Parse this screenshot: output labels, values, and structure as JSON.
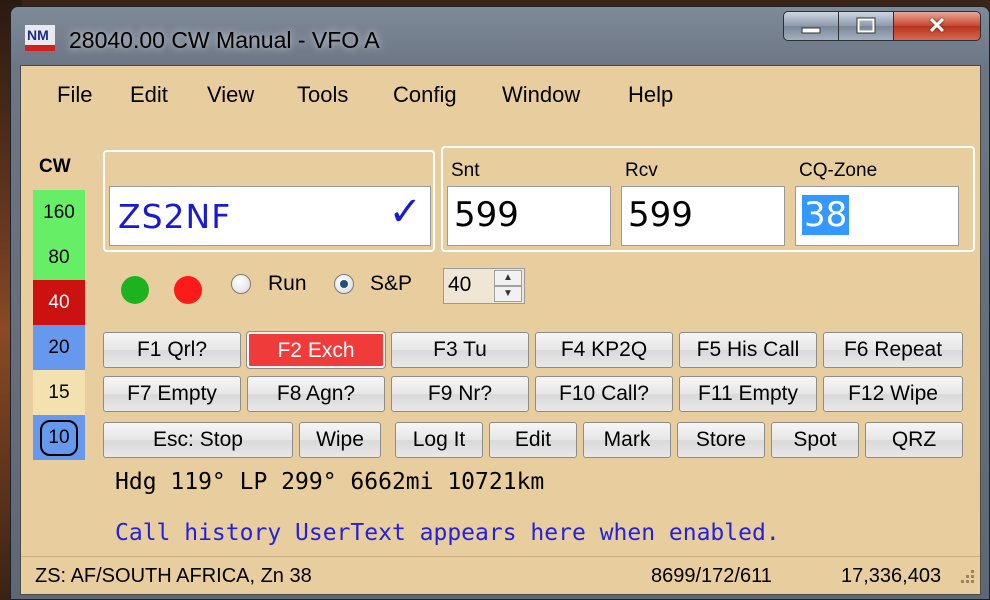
{
  "window": {
    "title": "28040.00 CW Manual - VFO A",
    "icon": "n1mm-logo-icon",
    "controls": [
      "minimize-icon",
      "maximize-icon",
      "close-icon"
    ],
    "close_glyph": "✕"
  },
  "menu": [
    "File",
    "Edit",
    "View",
    "Tools",
    "Config",
    "Window",
    "Help"
  ],
  "bands": {
    "mode_label": "CW",
    "items": [
      {
        "label": "160",
        "color": "#66ee66"
      },
      {
        "label": "80",
        "color": "#66ee66"
      },
      {
        "label": "40",
        "color": "#cc1111",
        "text_color": "#ffffff"
      },
      {
        "label": "20",
        "color": "#6699ee"
      },
      {
        "label": "15",
        "color": "#f3e2b0"
      },
      {
        "label": "10",
        "color": "#6699ee",
        "selected": true
      }
    ]
  },
  "entry": {
    "callsign": "ZS2NF",
    "check_glyph": "✓",
    "snt_label": "Snt",
    "snt_value": "599",
    "rcv_label": "Rcv",
    "rcv_value": "599",
    "zone_label": "CQ-Zone",
    "zone_value": "38"
  },
  "indicators": {
    "green": "#1fb21f",
    "red": "#ff1a1a"
  },
  "mode": {
    "run_label": "Run",
    "sp_label": "S&P",
    "selected": "S&P",
    "spin_value": "40"
  },
  "function_keys": {
    "row1": [
      "F1 Qrl?",
      "F2 Exch",
      "F3 Tu",
      "F4 KP2Q",
      "F5 His Call",
      "F6 Repeat"
    ],
    "row2": [
      "F7 Empty",
      "F8 Agn?",
      "F9 Nr?",
      "F10 Call?",
      "F11 Empty",
      "F12 Wipe"
    ],
    "row3": [
      "Esc: Stop",
      "Wipe",
      "Log It",
      "Edit",
      "Mark",
      "Store",
      "Spot",
      "QRZ"
    ],
    "active": "F2 Exch"
  },
  "info": {
    "heading": "Hdg 119° LP 299° 6662mi 10721km",
    "user_text": "Call history UserText appears here when enabled."
  },
  "status": {
    "country": "ZS: AF/SOUTH AFRICA, Zn 38",
    "counts": "8699/172/611",
    "score": "17,336,403"
  }
}
